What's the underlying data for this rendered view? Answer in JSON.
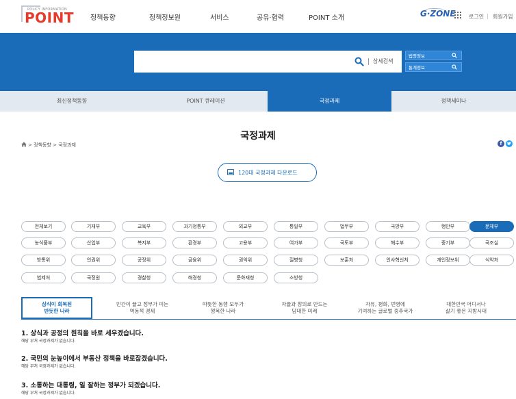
{
  "logo": {
    "small": "POLICY INFORMATION",
    "text": "POINT"
  },
  "nav": [
    "정책동향",
    "정책정보원",
    "서비스",
    "공유·협력",
    "POINT 소개"
  ],
  "gzone": "G·ZONE",
  "toplinks": {
    "login": "로그인",
    "join": "회원가입",
    "separator": "|"
  },
  "search": {
    "query": "",
    "advanced_label": "상세검색",
    "side_boxes": [
      "법령정보",
      "통계정보"
    ]
  },
  "tabs": [
    {
      "label": "최신정책동향",
      "active": false
    },
    {
      "label": "POINT 큐레이션",
      "active": false
    },
    {
      "label": "국정과제",
      "active": true
    },
    {
      "label": "정책세미나",
      "active": false
    }
  ],
  "page_title": "국정과제",
  "breadcrumb": "> 정책동향 > 국정과제",
  "social": {
    "facebook": "f"
  },
  "download_label": "120대 국정과제 다운로드",
  "ministries": [
    [
      "전체보기",
      "기재부",
      "교육부",
      "과기정통부",
      "외교부",
      "통일부",
      "법무부",
      "국방부",
      "행안부",
      "문체부"
    ],
    [
      "농식품부",
      "산업부",
      "복지부",
      "환경부",
      "고용부",
      "여가부",
      "국토부",
      "해수부",
      "중기부",
      "국조실"
    ],
    [
      "방통위",
      "인권위",
      "공정위",
      "금융위",
      "권익위",
      "질병청",
      "보훈처",
      "인사혁신처",
      "개인정보위",
      "식약처"
    ],
    [
      "법제처",
      "국정원",
      "경찰청",
      "해경청",
      "문화재청",
      "소방청"
    ]
  ],
  "active_ministry": "문체부",
  "categories": [
    {
      "line1": "상식이 회복된",
      "line2": "반듯한 나라",
      "active": true
    },
    {
      "line1": "민간이 끌고 정부가 미는",
      "line2": "역동적 경제",
      "active": false
    },
    {
      "line1": "따뜻한 동행 모두가",
      "line2": "행복한 나라",
      "active": false
    },
    {
      "line1": "자율과 창의로 만드는",
      "line2": "담대한 미래",
      "active": false
    },
    {
      "line1": "자유, 평화, 번영에",
      "line2": "기여하는 글로벌 중추국가",
      "active": false
    },
    {
      "line1": "대한민국 어디서나",
      "line2": "살기 좋은 지방시대",
      "active": false
    }
  ],
  "sections": [
    {
      "title": "1. 상식과 공정의 원칙을 바로 세우겠습니다.",
      "note": "해당 부처 국정과제가 없습니다."
    },
    {
      "title": "2. 국민의 눈높이에서 부동산 정책을 바로잡겠습니다.",
      "note": "해당 부처 국정과제가 없습니다."
    },
    {
      "title": "3. 소통하는 대통령, 일 잘하는 정부가 되겠습니다.",
      "note": "해당 부처 국정과제가 없습니다."
    }
  ],
  "colors": {
    "primary": "#1a6bb8",
    "logo_red": "#e43c2c",
    "tab_bg": "#e3e9f0"
  },
  "icons": [
    "search-icon",
    "grid-icon",
    "home-icon",
    "facebook-icon",
    "twitter-icon",
    "download-icon"
  ]
}
